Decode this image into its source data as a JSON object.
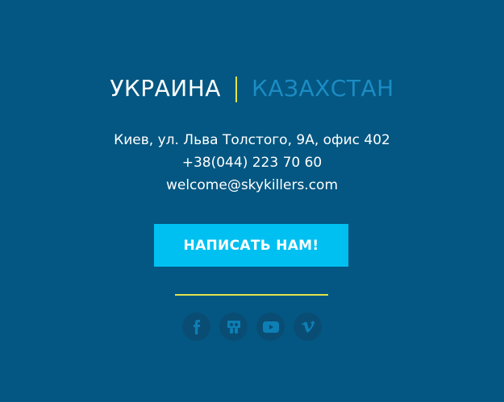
{
  "countries": {
    "active": "УКРАИНА",
    "inactive": "КАЗАХСТАН",
    "accent_color": "#e1e34a"
  },
  "contact": {
    "address": "Киев, ул. Льва Толстого, 9А, офис 402",
    "phone": "+38(044) 223 70 60",
    "email": "welcome@skykillers.com"
  },
  "cta": {
    "label": "НАПИСАТЬ НАМ!",
    "color": "#00c0f2"
  },
  "social": {
    "icons": [
      "facebook-icon",
      "slideshare-icon",
      "youtube-icon",
      "vimeo-icon"
    ],
    "icon_color": "#0d7fb5",
    "circle_color": "#0a4d74"
  },
  "theme": {
    "background": "#035782"
  }
}
